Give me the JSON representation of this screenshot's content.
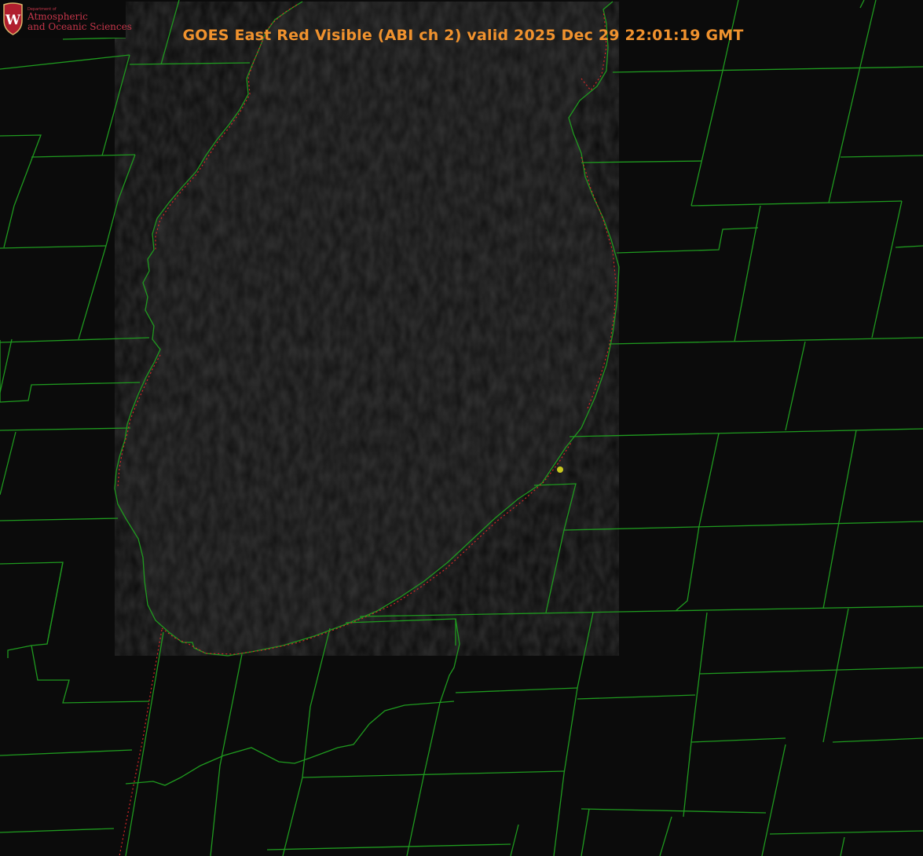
{
  "title": "GOES East Red Visible (ABI ch 2) valid 2025 Dec 29 22:01:19 GMT",
  "logo": {
    "department": "Department of",
    "line1": "Atmospheric",
    "line2": "and Oceanic Sciences",
    "crest_letter": "W"
  },
  "colors": {
    "background": "#0b0b0b",
    "title": "#f0922e",
    "county_lines": "#1f9a1f",
    "state_line": "#d22626",
    "marker": "#c8c81e",
    "logo_text": "#c5364a",
    "logo_crest": "#b01e2e"
  },
  "map": {
    "product": "GOES East Red Visible (ABI ch 2)",
    "features": [
      "county-boundaries",
      "state-boundary",
      "lake-shoreline",
      "location-marker"
    ]
  }
}
